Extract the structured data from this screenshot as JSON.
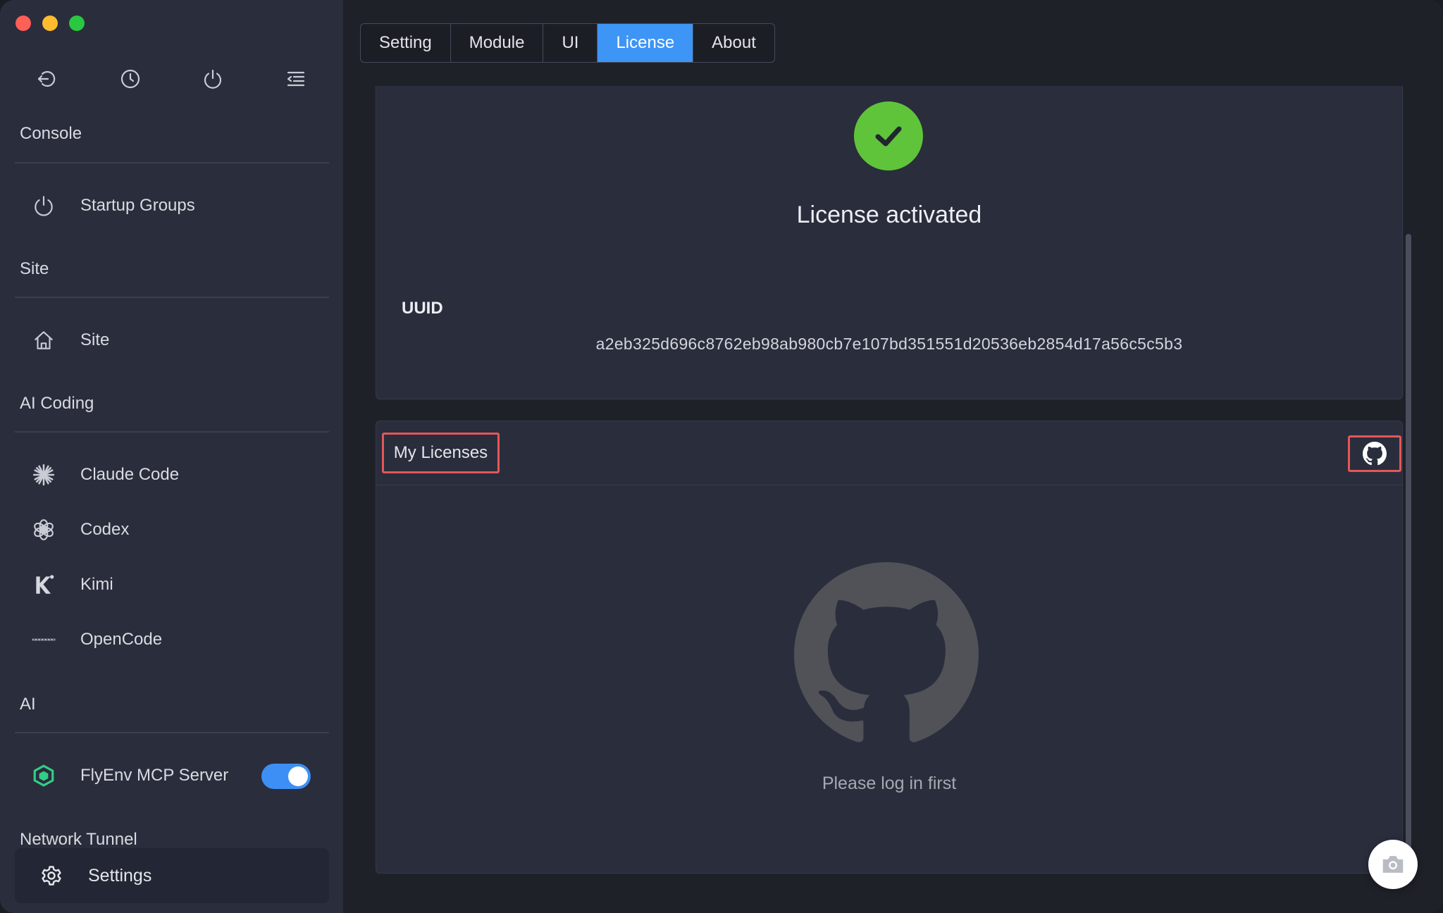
{
  "window": {
    "traffic_lights": [
      "close",
      "minimize",
      "zoom"
    ]
  },
  "sidebar": {
    "toolbar_icons": [
      "back-icon",
      "history-icon",
      "power-icon",
      "menu-collapse-icon"
    ],
    "sections": [
      {
        "title": "Console",
        "items": [
          {
            "label": "Startup Groups",
            "icon": "power-icon"
          }
        ]
      },
      {
        "title": "Site",
        "items": [
          {
            "label": "Site",
            "icon": "home-icon"
          }
        ]
      },
      {
        "title": "AI Coding",
        "items": [
          {
            "label": "Claude Code",
            "icon": "claude-icon"
          },
          {
            "label": "Codex",
            "icon": "openai-icon"
          },
          {
            "label": "Kimi",
            "icon": "kimi-icon"
          },
          {
            "label": "OpenCode",
            "icon": "opencode-icon"
          }
        ]
      },
      {
        "title": "AI",
        "items": [
          {
            "label": "FlyEnv MCP Server",
            "icon": "cube-icon",
            "toggle_on": true
          }
        ]
      },
      {
        "title": "Network Tunnel",
        "items": []
      }
    ],
    "settings": {
      "label": "Settings",
      "icon": "gear-icon",
      "active": true
    }
  },
  "tabs": [
    {
      "label": "Setting",
      "active": false
    },
    {
      "label": "Module",
      "active": false
    },
    {
      "label": "UI",
      "active": false
    },
    {
      "label": "License",
      "active": true
    },
    {
      "label": "About",
      "active": false
    }
  ],
  "license": {
    "status": "License activated",
    "uuid_label": "UUID",
    "uuid_value": "a2eb325d696c8762eb98ab980cb7e107bd351551d20536eb2854d17a56c5c5b3"
  },
  "my_licenses": {
    "title": "My Licenses",
    "github_icon": "github-icon",
    "empty_text": "Please log in first"
  },
  "colors": {
    "accent": "#3d95f6",
    "success": "#5fc43a",
    "highlight_border": "#e35757",
    "sidebar_bg": "#2a2d3c"
  }
}
